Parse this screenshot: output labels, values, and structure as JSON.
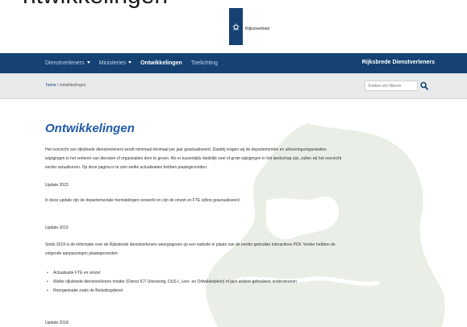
{
  "top_heading_cut": "ntwikkelingen",
  "logo": {
    "text": "Rijksoverheid",
    "icon": "royal-coat-of-arms-icon",
    "color": "#154273"
  },
  "nav": {
    "items": [
      {
        "label": "Dienstverleners",
        "dropdown": true,
        "active": false
      },
      {
        "label": "Ministeries",
        "dropdown": true,
        "active": false
      },
      {
        "label": "Ontwikkelingen",
        "dropdown": false,
        "active": true
      },
      {
        "label": "Toelichting",
        "dropdown": false,
        "active": false
      }
    ],
    "right_label": "Rijksbrede Dienstverleners"
  },
  "breadcrumb": {
    "home": "home",
    "separator": "/",
    "current": "ontwikkelingen"
  },
  "search": {
    "placeholder": "Zoeken e/o filteren",
    "icon": "search-icon"
  },
  "main": {
    "title": "Ontwikkelingen",
    "intro_lines": [
      "Het overzicht van rijksbrede dienstverleners wordt minimaal éénmaal per jaar geactualiseerd. Daarbij vragen wij de departementen en uitvoeringsorganisaties",
      "wijzigingen in het verleren van diensten of organisaties door te geven. Als er tussentijds duidelijk veel of grote wijzigingen in het landschap zijn, zullen wij het overzicht",
      "eerder actualiseren. Op deze pagina is te zien welke actualisaties hebben plaatsgevonden."
    ],
    "update_2023": {
      "heading": "Update 2023",
      "text": "In deze update zijn de departementale herindelingen verwerkt en zijn de omzet en FTE cijfers geactualiseerd."
    },
    "update_2019": {
      "heading": "Update 2019",
      "text_lines": [
        "Sinds 2019 is de informatie over de Rijksbrede dienstverleners weergegeven op een website in plaats van de eerder gebruikte interactieve PDF. Verder hebben de",
        "volgende aanpassingen plaatsgevonden:"
      ],
      "bullets": [
        "Actualisatie FTE en omzet",
        "Welke rijksbrede dienstverleners minder (Dienst ICT Uitvoering, DUS-I, Leer- en Ontwikkelplein) of juist andere gebruikers ondersteunen",
        "Reorganisatie zoals de Belastingdienst"
      ]
    },
    "update_2018": {
      "heading": "Update 2018"
    }
  },
  "colors": {
    "brand_blue": "#154273",
    "title_blue": "#1f5aa6",
    "crumb_bg": "#e8eaec",
    "watermark": "#e9efe6"
  }
}
